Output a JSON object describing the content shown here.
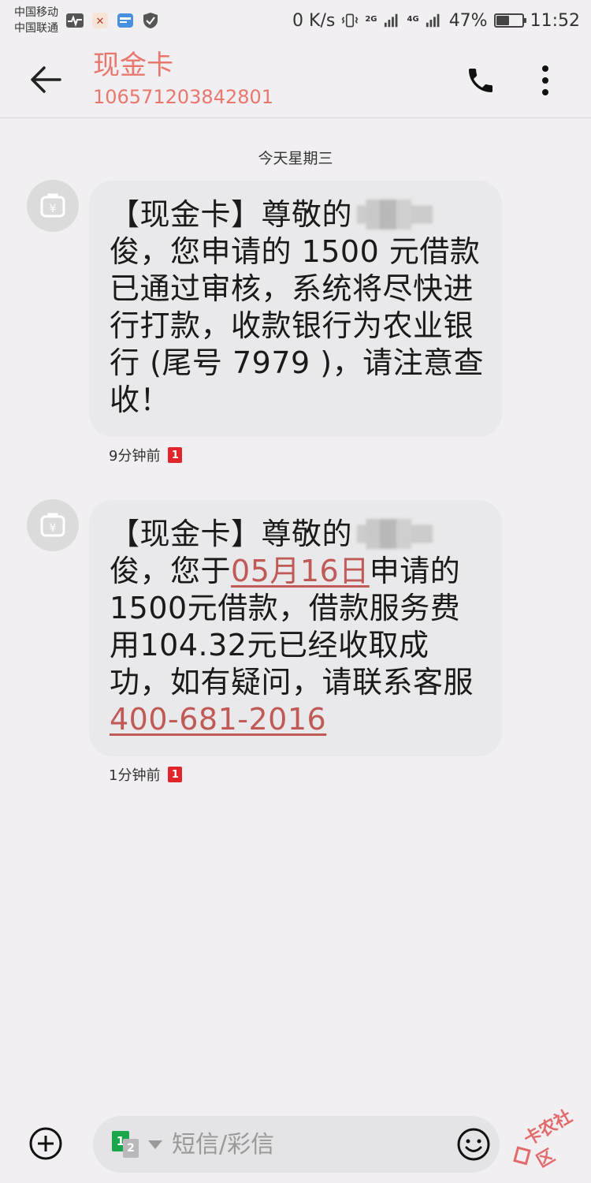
{
  "status_bar": {
    "carrier_1": "中国移动",
    "carrier_2": "中国联通",
    "network_speed": "0 K/s",
    "sim1_network": "2G",
    "sim2_network": "4G",
    "battery": "47%",
    "battery_level": 0.47,
    "time": "11:52",
    "icons": [
      "activity-icon",
      "app-notification-icon",
      "wallet-icon",
      "shield-icon",
      "vibrate-icon",
      "signal-icon",
      "battery-icon"
    ]
  },
  "header": {
    "contact_name": "现金卡",
    "contact_number": "106571203842801",
    "accent_color": "#e8776d",
    "icons": [
      "back-arrow-icon",
      "phone-icon",
      "more-vertical-icon"
    ]
  },
  "thread": {
    "date_separator": "今天星期三",
    "messages": [
      {
        "text_before_name": "【现金卡】尊敬的",
        "text_after_name": "俊，您申请的 1500 元借款已通过审核，系统将尽快进行打款，收款银行为农业银行 (尾号 7979 )，请注意查收！",
        "time": "9分钟前",
        "sim": "1"
      },
      {
        "text_before_name": "【现金卡】尊敬的",
        "text_mid_1": "俊，您于",
        "date_link": "05月16日",
        "text_mid_2": "申请的1500元借款，借款服务费用104.32元已经收取成功，如有疑问，请联系客服",
        "phone_link": "400-681-2016",
        "time": "1分钟前",
        "sim": "1"
      }
    ]
  },
  "composer": {
    "placeholder": "短信/彩信",
    "sim_primary": "1",
    "sim_secondary": "2",
    "sim_color": "#1aa64a",
    "icons": [
      "add-circle-icon",
      "sim-select-icon",
      "emoji-icon"
    ]
  },
  "watermark": {
    "text": "卡农社区"
  }
}
